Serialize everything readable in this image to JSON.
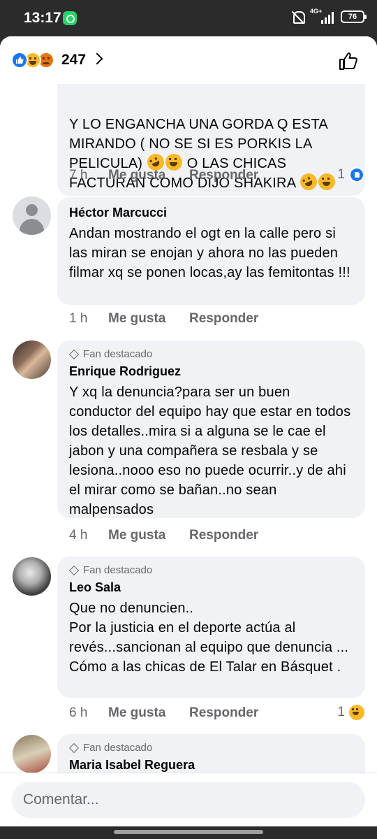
{
  "status_bar": {
    "time": "13:17",
    "network": "4G+",
    "battery": "76"
  },
  "reactions": {
    "count": "247"
  },
  "comments": [
    {
      "id": "partial-top",
      "lines": [
        "Y LO ENGANCHA UNA GORDA Q ESTA",
        "MIRANDO ( NO SE SI ES PORKIS LA",
        "PELICULA)",
        "O LAS CHICAS",
        "FACTURAN COMO DIJO SHAKIRA"
      ],
      "time": "7 h",
      "like_label": "Me gusta",
      "reply_label": "Responder",
      "reaction_count": "1"
    },
    {
      "id": "hector",
      "author": "Héctor Marcucci",
      "text": "Andan mostrando el ogt en la calle pero si las miran se enojan y ahora no las pueden filmar xq se ponen locas,ay las femitontas !!!",
      "time": "1 h",
      "like_label": "Me gusta",
      "reply_label": "Responder"
    },
    {
      "id": "enrique",
      "badge": "Fan destacado",
      "author": "Enrique Rodriguez",
      "text": "Y xq la denuncia?para ser un buen conductor del equipo hay que estar en todos los detalles..mira si a alguna se le cae el jabon y una compañera se resbala y se lesiona..nooo eso no puede ocurrir..y de ahi el mirar como se bañan..no sean malpensados",
      "time": "4 h",
      "like_label": "Me gusta",
      "reply_label": "Responder"
    },
    {
      "id": "leo",
      "badge": "Fan destacado",
      "author": "Leo Sala",
      "text_lines": [
        "Que no denuncien..",
        "Por la justicia en el deporte actúa al revés...sancionan al equipo que denuncia ... Cómo  a las chicas de El Talar  en Básquet ."
      ],
      "time": "6 h",
      "like_label": "Me gusta",
      "reply_label": "Responder",
      "reaction_count": "1"
    },
    {
      "id": "maria",
      "badge": "Fan destacado",
      "author": "Maria Isabel Reguera"
    }
  ],
  "composer": {
    "placeholder": "Comentar..."
  }
}
